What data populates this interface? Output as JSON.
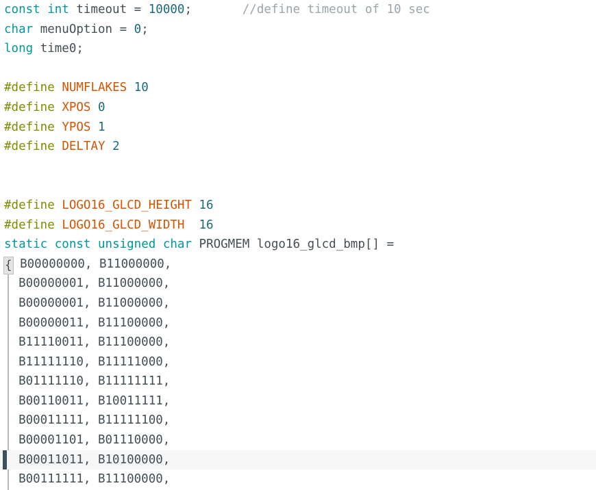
{
  "editor": {
    "app": "Arduino IDE code editor",
    "language": "C++ / Arduino sketch",
    "font_family": "monospace",
    "colors": {
      "background": "#ffffff",
      "keyword": "#00979c",
      "directive": "#7e8c00",
      "macro_name": "#d35400",
      "number": "#1b6a7a",
      "plain_text": "#434f54",
      "comment": "#9aa6ab",
      "current_line_background": "#f6f6f6",
      "current_line_marker": "#3c4f5c",
      "fold_guide": "#b9b9b9",
      "brace_match_background": "#e4e4e4"
    },
    "current_line_index": 22
  },
  "lines": [
    {
      "id": "line-1",
      "tokens": [
        {
          "t": "const",
          "c": "keyword"
        },
        {
          "t": " ",
          "c": "plain"
        },
        {
          "t": "int",
          "c": "keyword"
        },
        {
          "t": " timeout = ",
          "c": "plain"
        },
        {
          "t": "10000",
          "c": "number"
        },
        {
          "t": ";",
          "c": "plain"
        },
        {
          "t": "       ",
          "c": "plain"
        },
        {
          "t": "//define timeout of 10 sec",
          "c": "comment"
        }
      ]
    },
    {
      "id": "line-2",
      "tokens": [
        {
          "t": "char",
          "c": "keyword"
        },
        {
          "t": " menuOption = ",
          "c": "plain"
        },
        {
          "t": "0",
          "c": "number"
        },
        {
          "t": ";",
          "c": "plain"
        }
      ]
    },
    {
      "id": "line-3",
      "tokens": [
        {
          "t": "long",
          "c": "keyword"
        },
        {
          "t": " time0;",
          "c": "plain"
        }
      ]
    },
    {
      "id": "line-4",
      "tokens": []
    },
    {
      "id": "line-5",
      "tokens": [
        {
          "t": "#define",
          "c": "directive"
        },
        {
          "t": " ",
          "c": "plain"
        },
        {
          "t": "NUMFLAKES",
          "c": "macro"
        },
        {
          "t": " ",
          "c": "plain"
        },
        {
          "t": "10",
          "c": "number"
        }
      ]
    },
    {
      "id": "line-6",
      "tokens": [
        {
          "t": "#define",
          "c": "directive"
        },
        {
          "t": " ",
          "c": "plain"
        },
        {
          "t": "XPOS",
          "c": "macro"
        },
        {
          "t": " ",
          "c": "plain"
        },
        {
          "t": "0",
          "c": "number"
        }
      ]
    },
    {
      "id": "line-7",
      "tokens": [
        {
          "t": "#define",
          "c": "directive"
        },
        {
          "t": " ",
          "c": "plain"
        },
        {
          "t": "YPOS",
          "c": "macro"
        },
        {
          "t": " ",
          "c": "plain"
        },
        {
          "t": "1",
          "c": "number"
        }
      ]
    },
    {
      "id": "line-8",
      "tokens": [
        {
          "t": "#define",
          "c": "directive"
        },
        {
          "t": " ",
          "c": "plain"
        },
        {
          "t": "DELTAY",
          "c": "macro"
        },
        {
          "t": " ",
          "c": "plain"
        },
        {
          "t": "2",
          "c": "number"
        }
      ]
    },
    {
      "id": "line-9",
      "tokens": []
    },
    {
      "id": "line-10",
      "tokens": []
    },
    {
      "id": "line-11",
      "tokens": [
        {
          "t": "#define",
          "c": "directive"
        },
        {
          "t": " ",
          "c": "plain"
        },
        {
          "t": "LOGO16_GLCD_HEIGHT",
          "c": "macro"
        },
        {
          "t": " ",
          "c": "plain"
        },
        {
          "t": "16",
          "c": "number"
        }
      ]
    },
    {
      "id": "line-12",
      "tokens": [
        {
          "t": "#define",
          "c": "directive"
        },
        {
          "t": " ",
          "c": "plain"
        },
        {
          "t": "LOGO16_GLCD_WIDTH",
          "c": "macro"
        },
        {
          "t": "  ",
          "c": "plain"
        },
        {
          "t": "16",
          "c": "number"
        }
      ]
    },
    {
      "id": "line-13",
      "tokens": [
        {
          "t": "static",
          "c": "keyword"
        },
        {
          "t": " ",
          "c": "plain"
        },
        {
          "t": "const",
          "c": "keyword"
        },
        {
          "t": " ",
          "c": "plain"
        },
        {
          "t": "unsigned",
          "c": "keyword"
        },
        {
          "t": " ",
          "c": "plain"
        },
        {
          "t": "char",
          "c": "keyword"
        },
        {
          "t": " PROGMEM logo16_glcd_bmp[] =",
          "c": "plain"
        }
      ]
    },
    {
      "id": "line-14",
      "brace": "{",
      "tokens": [
        {
          "t": " B00000000, B11000000,",
          "c": "data"
        }
      ]
    },
    {
      "id": "line-15",
      "tokens": [
        {
          "t": "  B00000001, B11000000,",
          "c": "data"
        }
      ]
    },
    {
      "id": "line-16",
      "tokens": [
        {
          "t": "  B00000001, B11000000,",
          "c": "data"
        }
      ]
    },
    {
      "id": "line-17",
      "tokens": [
        {
          "t": "  B00000011, B11100000,",
          "c": "data"
        }
      ]
    },
    {
      "id": "line-18",
      "tokens": [
        {
          "t": "  B11110011, B11100000,",
          "c": "data"
        }
      ]
    },
    {
      "id": "line-19",
      "tokens": [
        {
          "t": "  B11111110, B11111000,",
          "c": "data"
        }
      ]
    },
    {
      "id": "line-20",
      "tokens": [
        {
          "t": "  B01111110, B11111111,",
          "c": "data"
        }
      ]
    },
    {
      "id": "line-21",
      "tokens": [
        {
          "t": "  B00110011, B10011111,",
          "c": "data"
        }
      ]
    },
    {
      "id": "line-22",
      "tokens": [
        {
          "t": "  B00011111, B11111100,",
          "c": "data"
        }
      ]
    },
    {
      "id": "line-23",
      "tokens": [
        {
          "t": "  B00001101, B01110000,",
          "c": "data"
        }
      ]
    },
    {
      "id": "line-24",
      "current": true,
      "tokens": [
        {
          "t": "  B00011011, B10100000,",
          "c": "data"
        }
      ]
    },
    {
      "id": "line-25",
      "tokens": [
        {
          "t": "  B00111111, B11100000,",
          "c": "data"
        }
      ]
    }
  ]
}
